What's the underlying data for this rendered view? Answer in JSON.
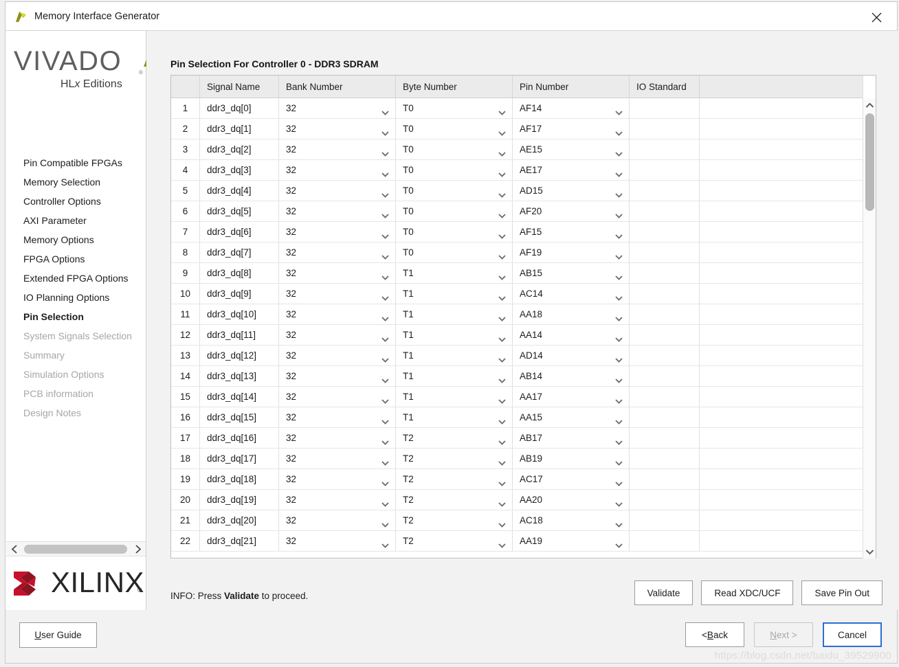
{
  "window": {
    "title": "Memory Interface Generator",
    "app_icon": "vivado-arrow-icon",
    "close_icon": "close-icon"
  },
  "sidebar": {
    "logo": {
      "wordmark": "VIVADO",
      "registered": "®",
      "subtitle_prefix": "HL",
      "subtitle_italic": "x",
      "subtitle_suffix": " Editions"
    },
    "items": [
      {
        "label": "Pin Compatible FPGAs",
        "state": "enabled"
      },
      {
        "label": "Memory Selection",
        "state": "enabled"
      },
      {
        "label": "Controller Options",
        "state": "enabled"
      },
      {
        "label": "AXI Parameter",
        "state": "enabled"
      },
      {
        "label": "Memory Options",
        "state": "enabled"
      },
      {
        "label": "FPGA Options",
        "state": "enabled"
      },
      {
        "label": "Extended FPGA Options",
        "state": "enabled"
      },
      {
        "label": "IO Planning Options",
        "state": "enabled"
      },
      {
        "label": "Pin Selection",
        "state": "current"
      },
      {
        "label": "System Signals Selection",
        "state": "disabled"
      },
      {
        "label": "Summary",
        "state": "disabled"
      },
      {
        "label": "Simulation Options",
        "state": "disabled"
      },
      {
        "label": "PCB information",
        "state": "disabled"
      },
      {
        "label": "Design Notes",
        "state": "disabled"
      }
    ],
    "scroll": {
      "left_icon": "chevron-left-icon",
      "right_icon": "chevron-right-icon"
    },
    "brand": {
      "wordmark": "XILINX",
      "registered": "®"
    }
  },
  "main": {
    "panel_title": "Pin Selection For Controller 0 - DDR3 SDRAM",
    "table": {
      "columns": [
        "",
        "Signal Name",
        "Bank Number",
        "Byte Number",
        "Pin Number",
        "IO Standard",
        ""
      ],
      "rows": [
        {
          "index": "1",
          "signal_name": "ddr3_dq[0]",
          "bank_number": "32",
          "byte_number": "T0",
          "pin_number": "AF14",
          "io_standard": ""
        },
        {
          "index": "2",
          "signal_name": "ddr3_dq[1]",
          "bank_number": "32",
          "byte_number": "T0",
          "pin_number": "AF17",
          "io_standard": ""
        },
        {
          "index": "3",
          "signal_name": "ddr3_dq[2]",
          "bank_number": "32",
          "byte_number": "T0",
          "pin_number": "AE15",
          "io_standard": ""
        },
        {
          "index": "4",
          "signal_name": "ddr3_dq[3]",
          "bank_number": "32",
          "byte_number": "T0",
          "pin_number": "AE17",
          "io_standard": ""
        },
        {
          "index": "5",
          "signal_name": "ddr3_dq[4]",
          "bank_number": "32",
          "byte_number": "T0",
          "pin_number": "AD15",
          "io_standard": ""
        },
        {
          "index": "6",
          "signal_name": "ddr3_dq[5]",
          "bank_number": "32",
          "byte_number": "T0",
          "pin_number": "AF20",
          "io_standard": ""
        },
        {
          "index": "7",
          "signal_name": "ddr3_dq[6]",
          "bank_number": "32",
          "byte_number": "T0",
          "pin_number": "AF15",
          "io_standard": ""
        },
        {
          "index": "8",
          "signal_name": "ddr3_dq[7]",
          "bank_number": "32",
          "byte_number": "T0",
          "pin_number": "AF19",
          "io_standard": ""
        },
        {
          "index": "9",
          "signal_name": "ddr3_dq[8]",
          "bank_number": "32",
          "byte_number": "T1",
          "pin_number": "AB15",
          "io_standard": ""
        },
        {
          "index": "10",
          "signal_name": "ddr3_dq[9]",
          "bank_number": "32",
          "byte_number": "T1",
          "pin_number": "AC14",
          "io_standard": ""
        },
        {
          "index": "11",
          "signal_name": "ddr3_dq[10]",
          "bank_number": "32",
          "byte_number": "T1",
          "pin_number": "AA18",
          "io_standard": ""
        },
        {
          "index": "12",
          "signal_name": "ddr3_dq[11]",
          "bank_number": "32",
          "byte_number": "T1",
          "pin_number": "AA14",
          "io_standard": ""
        },
        {
          "index": "13",
          "signal_name": "ddr3_dq[12]",
          "bank_number": "32",
          "byte_number": "T1",
          "pin_number": "AD14",
          "io_standard": ""
        },
        {
          "index": "14",
          "signal_name": "ddr3_dq[13]",
          "bank_number": "32",
          "byte_number": "T1",
          "pin_number": "AB14",
          "io_standard": ""
        },
        {
          "index": "15",
          "signal_name": "ddr3_dq[14]",
          "bank_number": "32",
          "byte_number": "T1",
          "pin_number": "AA17",
          "io_standard": ""
        },
        {
          "index": "16",
          "signal_name": "ddr3_dq[15]",
          "bank_number": "32",
          "byte_number": "T1",
          "pin_number": "AA15",
          "io_standard": ""
        },
        {
          "index": "17",
          "signal_name": "ddr3_dq[16]",
          "bank_number": "32",
          "byte_number": "T2",
          "pin_number": "AB17",
          "io_standard": ""
        },
        {
          "index": "18",
          "signal_name": "ddr3_dq[17]",
          "bank_number": "32",
          "byte_number": "T2",
          "pin_number": "AB19",
          "io_standard": ""
        },
        {
          "index": "19",
          "signal_name": "ddr3_dq[18]",
          "bank_number": "32",
          "byte_number": "T2",
          "pin_number": "AC17",
          "io_standard": ""
        },
        {
          "index": "20",
          "signal_name": "ddr3_dq[19]",
          "bank_number": "32",
          "byte_number": "T2",
          "pin_number": "AA20",
          "io_standard": ""
        },
        {
          "index": "21",
          "signal_name": "ddr3_dq[20]",
          "bank_number": "32",
          "byte_number": "T2",
          "pin_number": "AC18",
          "io_standard": ""
        },
        {
          "index": "22",
          "signal_name": "ddr3_dq[21]",
          "bank_number": "32",
          "byte_number": "T2",
          "pin_number": "AA19",
          "io_standard": ""
        }
      ],
      "dropdown_icon": "chevron-down-icon",
      "scroll_up_icon": "chevron-up-icon",
      "scroll_down_icon": "chevron-down-icon"
    },
    "info": {
      "prefix": "INFO: Press ",
      "emphasis": "Validate",
      "suffix": " to proceed."
    },
    "actions": [
      {
        "label": "Validate"
      },
      {
        "label": "Read XDC/UCF"
      },
      {
        "label": "Save Pin Out"
      }
    ]
  },
  "footer": {
    "user_guide": {
      "mnemonic": "U",
      "rest": "ser Guide"
    },
    "back": {
      "prefix": "< ",
      "mnemonic": "B",
      "rest": "ack"
    },
    "next": {
      "mnemonic": "N",
      "rest": "ext >",
      "state": "disabled"
    },
    "cancel": {
      "label": "Cancel",
      "state": "focused"
    }
  },
  "watermark": "https://blog.csdn.net/baidu_39529900",
  "colors": {
    "accent_blue": "#2b6dd6",
    "vivado_gray": "#5f5f5f",
    "vivado_green_light": "#d4df38",
    "vivado_green_dark": "#8d9118",
    "xilinx_red": "#c8102e",
    "xilinx_dark_red": "#8c1420",
    "header_bg": "#ebebeb"
  }
}
